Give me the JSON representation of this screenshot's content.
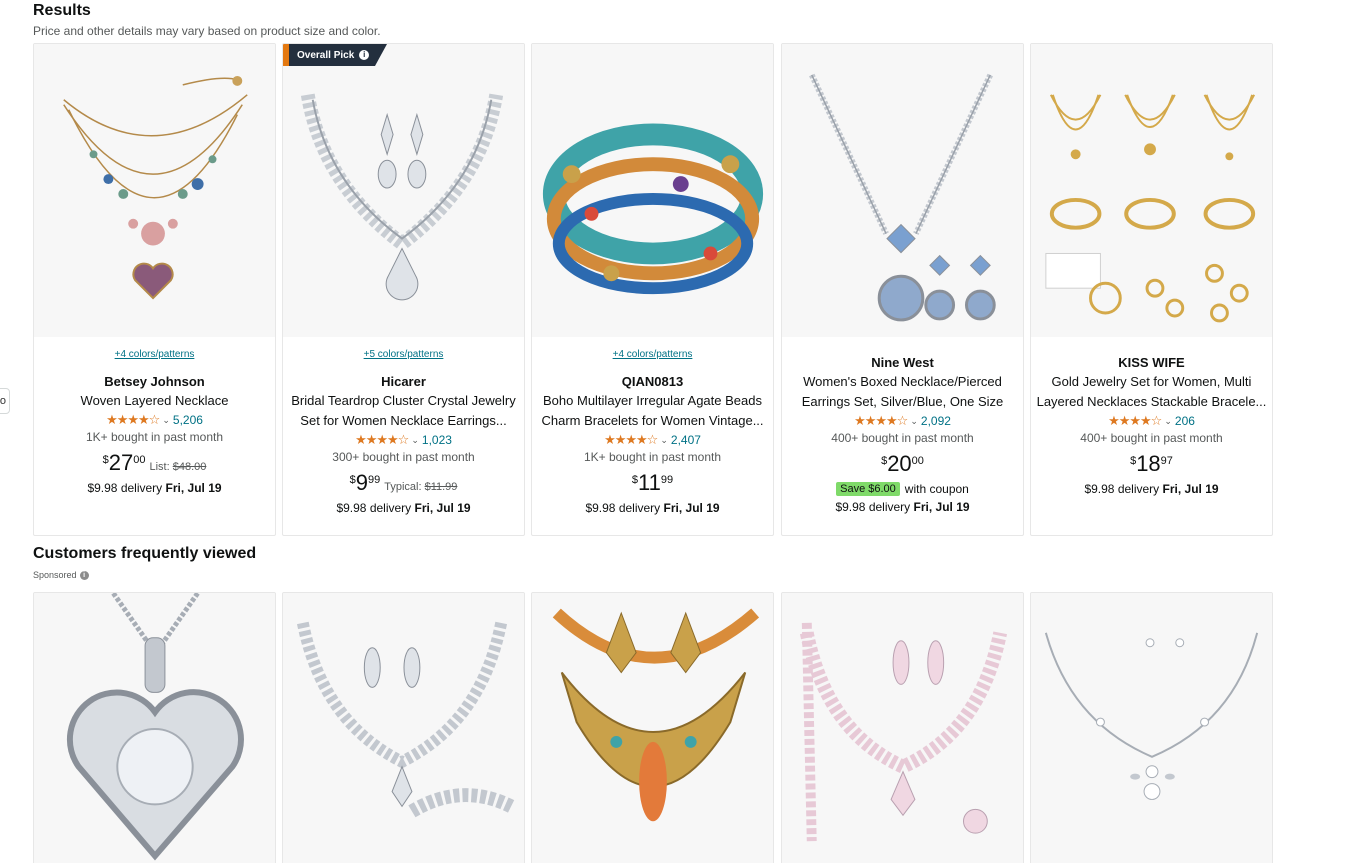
{
  "results": {
    "title": "Results",
    "subtitle": "Price and other details may vary based on product size and color.",
    "badge": {
      "label": "Overall Pick"
    },
    "products": [
      {
        "swatches": "+4 colors/patterns",
        "brand": "Betsey Johnson",
        "title": "Woven Layered Necklace",
        "stars": "4.5",
        "rating_count": "5,206",
        "bought": "1K+ bought in past month",
        "price": {
          "symbol": "$",
          "whole": "27",
          "fraction": "00"
        },
        "list_label": "List:",
        "list_price": "$48.00",
        "delivery_prefix": "$9.98 delivery",
        "delivery_date": "Fri, Jul 19"
      },
      {
        "swatches": "+5 colors/patterns",
        "brand": "Hicarer",
        "title": "Bridal Teardrop Cluster Crystal Jewelry Set for Women Necklace Earrings...",
        "stars": "4.5",
        "rating_count": "1,023",
        "bought": "300+ bought in past month",
        "price": {
          "symbol": "$",
          "whole": "9",
          "fraction": "99"
        },
        "list_label": "Typical:",
        "list_price": "$11.99",
        "delivery_prefix": "$9.98 delivery",
        "delivery_date": "Fri, Jul 19"
      },
      {
        "swatches": "+4 colors/patterns",
        "brand": "QIAN0813",
        "title": "Boho Multilayer Irregular Agate Beads Charm Bracelets for Women Vintage...",
        "stars": "4.5",
        "rating_count": "2,407",
        "bought": "1K+ bought in past month",
        "price": {
          "symbol": "$",
          "whole": "11",
          "fraction": "99"
        },
        "delivery_prefix": "$9.98 delivery",
        "delivery_date": "Fri, Jul 19"
      },
      {
        "brand": "Nine West",
        "title": "Women's Boxed Necklace/Pierced Earrings Set, Silver/Blue, One Size",
        "stars": "4.5",
        "rating_count": "2,092",
        "bought": "400+ bought in past month",
        "price": {
          "symbol": "$",
          "whole": "20",
          "fraction": "00"
        },
        "coupon": "Save $6.00",
        "coupon_text": "with coupon",
        "delivery_prefix": "$9.98 delivery",
        "delivery_date": "Fri, Jul 19"
      },
      {
        "brand": "KISS WIFE",
        "title": "Gold Jewelry Set for Women, Multi Layered Necklaces Stackable Bracele...",
        "stars": "4.0",
        "rating_count": "206",
        "bought": "400+ bought in past month",
        "price": {
          "symbol": "$",
          "whole": "18",
          "fraction": "97"
        },
        "delivery_prefix": "$9.98 delivery",
        "delivery_date": "Fri, Jul 19"
      }
    ]
  },
  "customers_viewed": {
    "title": "Customers frequently viewed",
    "sponsored": "Sponsored"
  },
  "edge_tab": "o",
  "colors": {
    "link": "#007185",
    "star": "#de7921",
    "coupon": "#7fda69",
    "badge_bg": "#232f3e",
    "badge_accent": "#e47911"
  },
  "icons": [
    "info-icon",
    "star-icon",
    "chevron-down-icon"
  ]
}
